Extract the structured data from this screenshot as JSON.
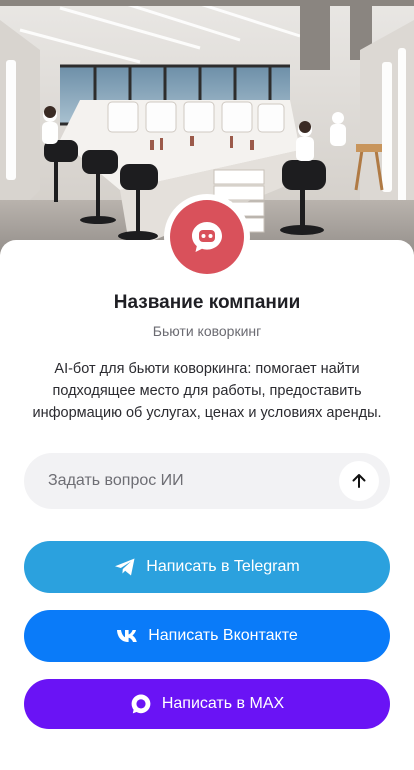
{
  "company": {
    "name": "Название компании",
    "subtitle": "Бьюти коворкинг",
    "description": "AI-бот для бьюти коворкинга: помогает найти подходящее место для работы, предоставить информацию об услугах, ценах и условиях аренды."
  },
  "ask": {
    "placeholder": "Задать вопрос ИИ",
    "send_icon": "arrow-up-icon"
  },
  "buttons": {
    "telegram": {
      "label": "Написать в Telegram",
      "icon": "telegram-icon",
      "color": "#2ba1de"
    },
    "vk": {
      "label": "Написать Вконтакте",
      "icon": "vk-icon",
      "color": "#0a7bf9"
    },
    "max": {
      "label": "Написать в MAX",
      "icon": "max-icon",
      "color": "#6a13f5"
    }
  },
  "avatar": {
    "icon": "chat-bot-icon",
    "color": "#d9515b"
  }
}
